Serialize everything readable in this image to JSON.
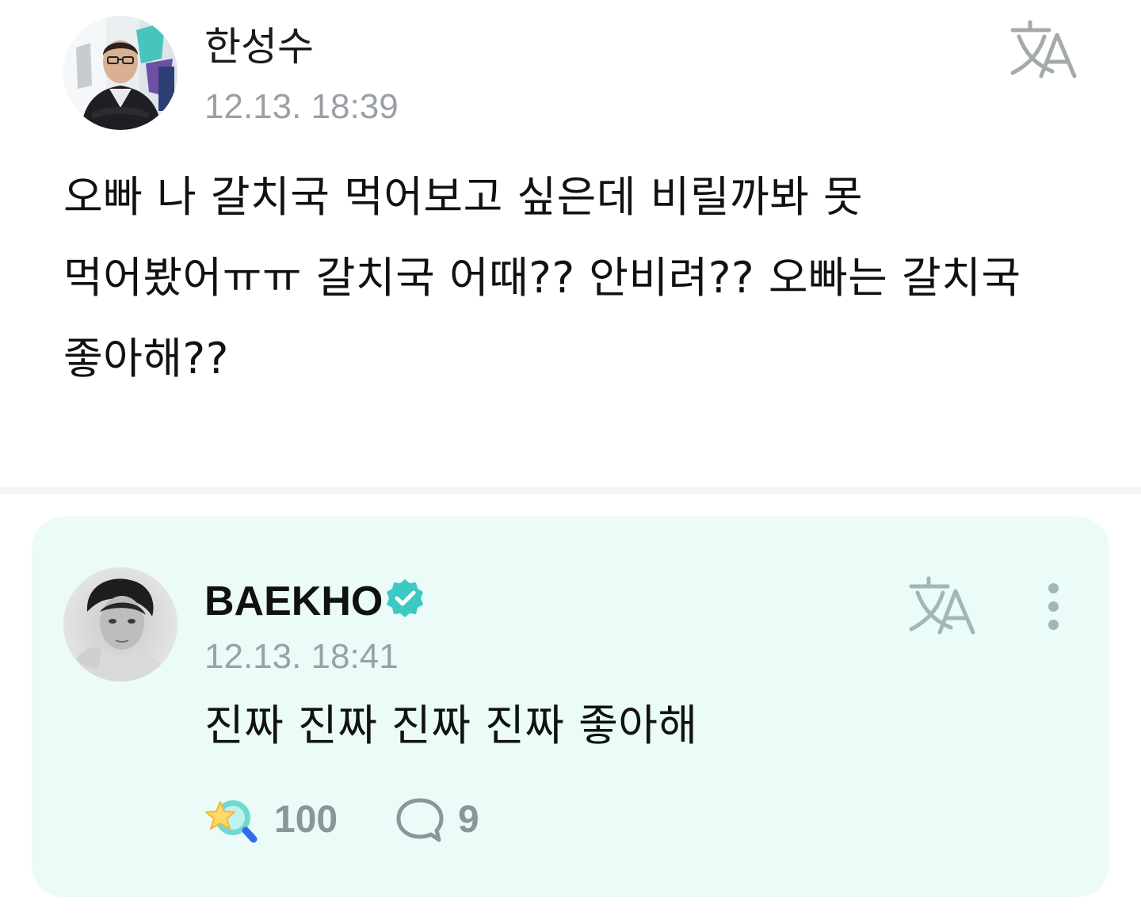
{
  "post": {
    "author": "한성수",
    "timestamp": "12.13. 18:39",
    "body": "오빠 나 갈치국 먹어보고 싶은데 비릴까봐 못 먹어봤어ㅠㅠ 갈치국 어때?? 안비려?? 오빠는 갈치국 좋아해??",
    "icons": {
      "avatar": "profile-photo",
      "translate": "translate-icon"
    }
  },
  "reply": {
    "author": "BAEKHO",
    "verified": true,
    "timestamp": "12.13. 18:41",
    "body": "진짜 진짜 진짜 진짜 좋아해",
    "like_count": "100",
    "comment_count": "9",
    "icons": {
      "avatar": "profile-photo",
      "verified": "verified-badge-icon",
      "translate": "translate-icon",
      "more": "more-vertical-icon",
      "like": "star-magnifier-like-icon",
      "comment": "speech-bubble-icon"
    }
  },
  "colors": {
    "card_background": "#eafbf8",
    "accent": "#3cc8c3",
    "muted_text": "#9aa0a6",
    "icon_gray": "#a4aaac",
    "icon_teal_gray": "#9fb8b7"
  }
}
